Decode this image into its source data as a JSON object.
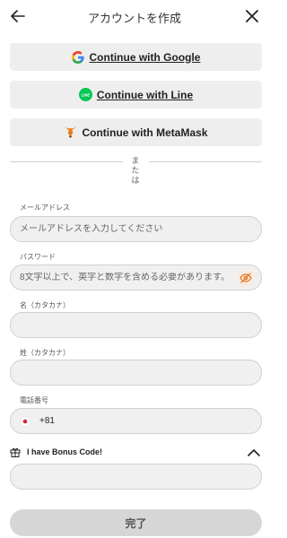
{
  "header": {
    "title": "アカウントを作成",
    "back_icon": "arrow-left-icon",
    "close_icon": "close-icon"
  },
  "oauth": {
    "google": {
      "label": "Continue with Google",
      "icon": "google-icon"
    },
    "line": {
      "label": "Continue with Line",
      "icon": "line-icon",
      "color": "#06c755"
    },
    "metamask": {
      "label": "Continue with MetaMask",
      "icon": "metamask-icon",
      "color": "#e2761b"
    }
  },
  "divider": {
    "text_lines": [
      "ま",
      "た",
      "は"
    ]
  },
  "email": {
    "label": "メールアドレス",
    "placeholder": "メールアドレスを入力してください",
    "value": ""
  },
  "password": {
    "label": "パスワード",
    "placeholder": "8文字以上で、英字と数字を含める必要があります。",
    "value": "",
    "toggle_icon": "eye-off-icon"
  },
  "first_name": {
    "label": "名（カタカナ）",
    "value": ""
  },
  "last_name": {
    "label": "姓（カタカナ）",
    "value": ""
  },
  "phone": {
    "label": "電話番号",
    "country_code": "+81",
    "flag_icon": "japan-flag-icon",
    "value": ""
  },
  "bonus": {
    "label": "I have Bonus Code!",
    "icon": "gift-icon",
    "chevron_icon": "chevron-up-icon",
    "value": ""
  },
  "submit": {
    "label": "完了"
  },
  "colors": {
    "field_bg": "#f0f0f0",
    "button_bg": "#eeeeee",
    "submit_bg": "#d6d6d6",
    "accent": "#e2761b"
  }
}
